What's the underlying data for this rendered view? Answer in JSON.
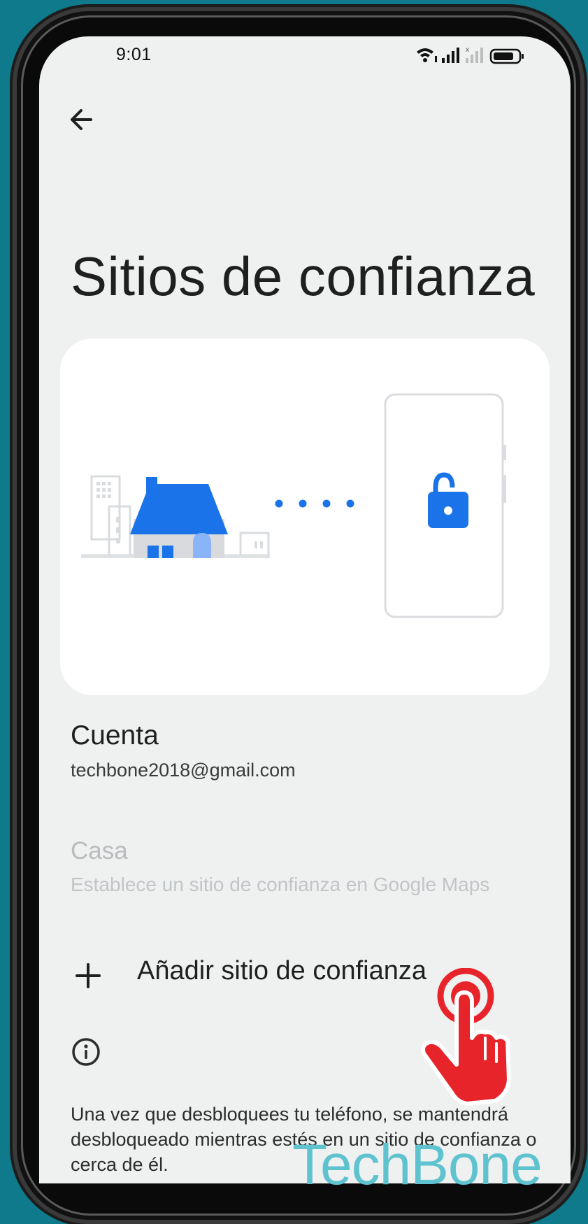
{
  "status_bar": {
    "time": "9:01"
  },
  "header": {
    "back_label": ""
  },
  "page": {
    "title": "Sitios de confianza"
  },
  "account": {
    "title": "Cuenta",
    "email": "techbone2018@gmail.com"
  },
  "trusted_places": [
    {
      "title": "Casa",
      "subtitle": "Establece un sitio de confianza en Google Maps",
      "enabled": false
    }
  ],
  "add_place": {
    "label": "Añadir sitio de confianza"
  },
  "info": {
    "text": "Una vez que desbloquees tu teléfono, se mantendrá desbloqueado mientras estés en un sitio de confianza o cerca de él."
  },
  "watermark": {
    "text": "TechBone"
  },
  "icons": [
    "back-arrow-icon",
    "wifi-icon",
    "signal-icon",
    "battery-icon",
    "house-icon",
    "lock-open-icon",
    "plus-icon",
    "info-icon",
    "tap-hand-icon"
  ],
  "colors": {
    "accent": "#1a73e8",
    "background": "#0f7a8b",
    "screen": "#eff0f0",
    "watermark": "#5fc3cf",
    "tap": "#e8242b"
  }
}
